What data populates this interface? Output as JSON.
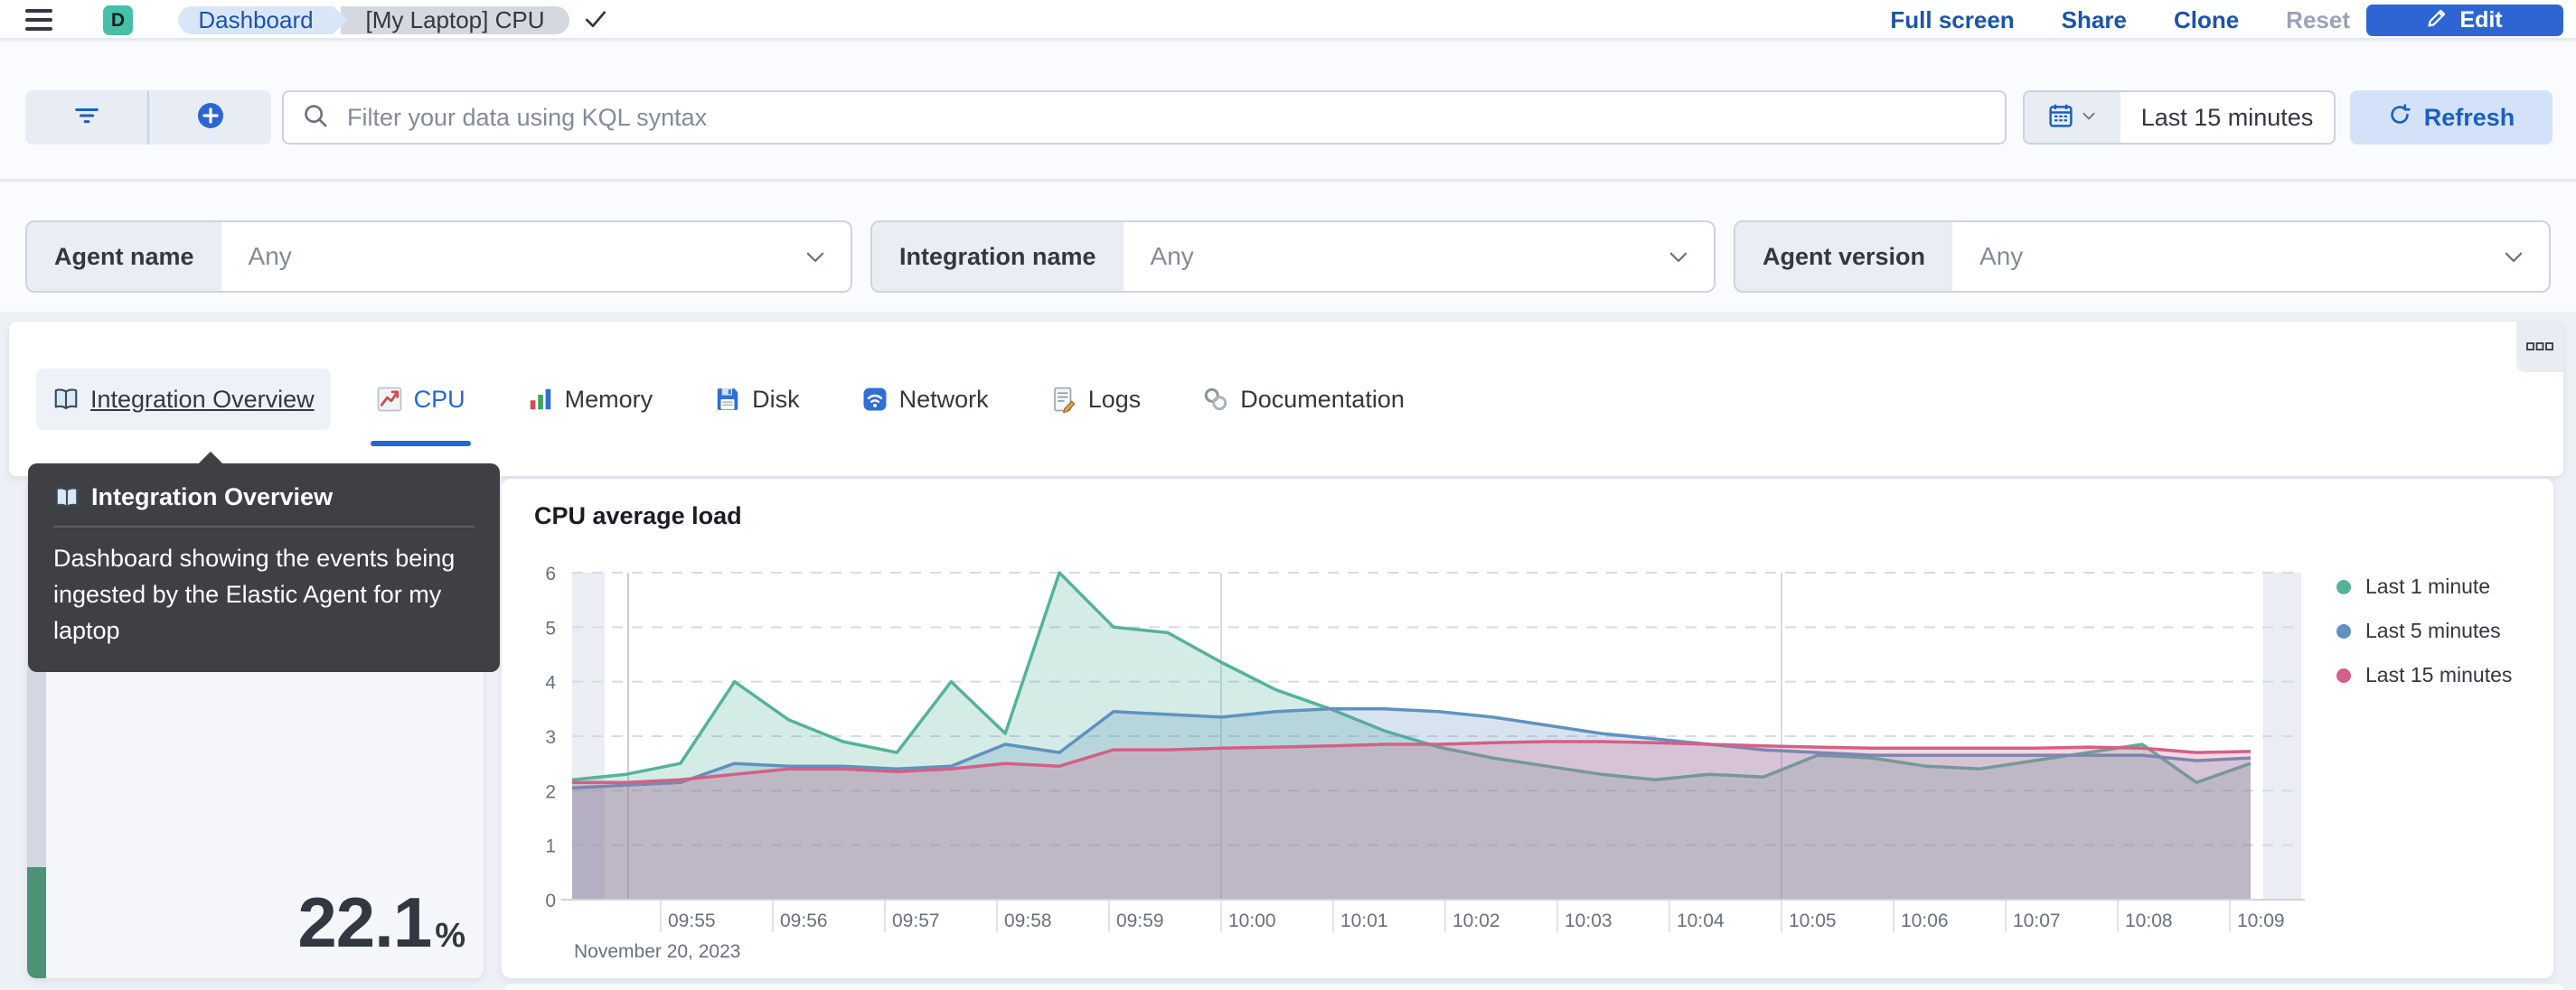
{
  "header": {
    "space_initial": "D",
    "breadcrumbs": [
      "Dashboard",
      "[My Laptop] CPU"
    ],
    "actions": [
      {
        "label": "Full screen",
        "disabled": false
      },
      {
        "label": "Share",
        "disabled": false
      },
      {
        "label": "Clone",
        "disabled": false
      },
      {
        "label": "Reset",
        "disabled": true
      }
    ],
    "edit_label": "Edit"
  },
  "toolbar": {
    "search_placeholder": "Filter your data using KQL syntax",
    "time_range": "Last 15 minutes",
    "refresh_label": "Refresh"
  },
  "filters": [
    {
      "label": "Agent name",
      "value": "Any"
    },
    {
      "label": "Integration name",
      "value": "Any"
    },
    {
      "label": "Agent version",
      "value": "Any"
    }
  ],
  "tabs": [
    {
      "label": "Integration Overview",
      "icon": "book-icon",
      "state": "hover"
    },
    {
      "label": "CPU",
      "icon": "chart-increasing-icon",
      "state": "selected"
    },
    {
      "label": "Memory",
      "icon": "bar-chart-icon",
      "state": "normal"
    },
    {
      "label": "Disk",
      "icon": "floppy-disk-icon",
      "state": "normal"
    },
    {
      "label": "Network",
      "icon": "antenna-icon",
      "state": "normal"
    },
    {
      "label": "Logs",
      "icon": "memo-icon",
      "state": "normal"
    },
    {
      "label": "Documentation",
      "icon": "link-icon",
      "state": "normal"
    }
  ],
  "tooltip": {
    "title": "Integration Overview",
    "body": "Dashboard showing the events being ingested by the Elastic Agent for my laptop"
  },
  "metric_panel": {
    "value": "22.1",
    "unit": "%",
    "bar_fill_percent": 22.1,
    "bar_color": "#4d9179"
  },
  "chart_data": {
    "type": "area",
    "title": "CPU average load",
    "x_tick_labels": [
      "09:55",
      "09:56",
      "09:57",
      "09:58",
      "09:59",
      "10:00",
      "10:01",
      "10:02",
      "10:03",
      "10:04",
      "10:05",
      "10:06",
      "10:07",
      "10:08",
      "10:09"
    ],
    "x_context_label": "November 20, 2023",
    "ylabel": "",
    "xlabel": "",
    "ylim": [
      0,
      6
    ],
    "y_ticks": [
      0,
      1,
      2,
      3,
      4,
      5,
      6
    ],
    "grid": "horizontal-dashed",
    "legend_position": "right",
    "series": [
      {
        "name": "Last 1 minute",
        "color": "#54B399",
        "values": [
          2.2,
          2.3,
          2.5,
          4.0,
          3.3,
          2.9,
          2.7,
          4.0,
          3.05,
          6.0,
          5.0,
          4.9,
          4.35,
          3.85,
          3.5,
          3.1,
          2.8,
          2.6,
          2.45,
          2.3,
          2.2,
          2.3,
          2.25,
          2.65,
          2.6,
          2.45,
          2.4,
          2.55,
          2.7,
          2.85,
          2.15,
          2.5
        ]
      },
      {
        "name": "Last 5 minutes",
        "color": "#6092C0",
        "values": [
          2.05,
          2.1,
          2.15,
          2.5,
          2.45,
          2.45,
          2.4,
          2.45,
          2.85,
          2.7,
          3.45,
          3.4,
          3.35,
          3.45,
          3.5,
          3.5,
          3.45,
          3.35,
          3.2,
          3.05,
          2.95,
          2.85,
          2.75,
          2.7,
          2.65,
          2.65,
          2.65,
          2.65,
          2.65,
          2.65,
          2.55,
          2.6
        ]
      },
      {
        "name": "Last 15 minutes",
        "color": "#D36086",
        "values": [
          2.15,
          2.15,
          2.2,
          2.3,
          2.4,
          2.4,
          2.35,
          2.4,
          2.5,
          2.45,
          2.75,
          2.75,
          2.78,
          2.8,
          2.82,
          2.85,
          2.85,
          2.88,
          2.9,
          2.9,
          2.88,
          2.85,
          2.82,
          2.8,
          2.78,
          2.78,
          2.78,
          2.78,
          2.8,
          2.78,
          2.7,
          2.72
        ]
      }
    ]
  }
}
